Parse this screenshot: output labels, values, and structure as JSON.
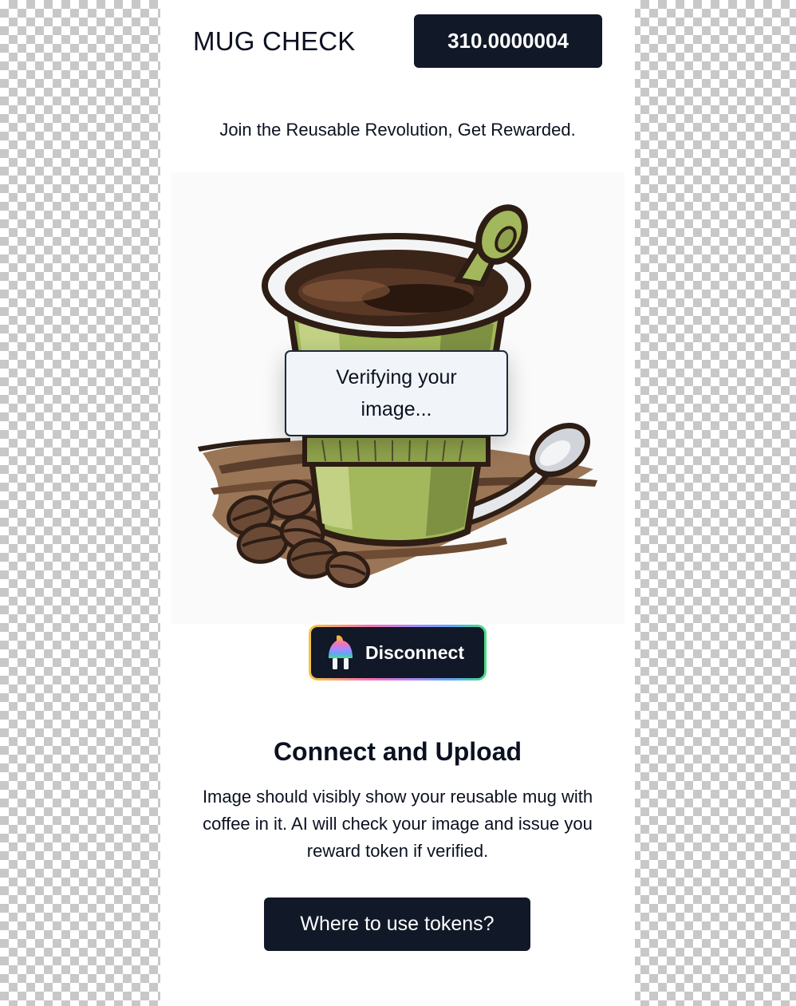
{
  "header": {
    "brand": "MUG CHECK",
    "balance": "310.0000004"
  },
  "tagline": "Join the Reusable Revolution, Get Rewarded.",
  "hero": {
    "illustration": "coffee-cup-illustration",
    "status_text": "Verifying your image..."
  },
  "wallet": {
    "disconnect_label": "Disconnect",
    "icon": "plug-icon"
  },
  "instructions": {
    "title": "Connect and Upload",
    "description": "Image should visibly show your reusable mug with coffee in it. AI will check your image and issue you reward token if verified."
  },
  "actions": {
    "tokens_button": "Where to use tokens?"
  },
  "colors": {
    "dark": "#111827",
    "cup_green": "#a3b85c",
    "coffee": "#3b2418",
    "panel_bg": "#ffffff"
  }
}
